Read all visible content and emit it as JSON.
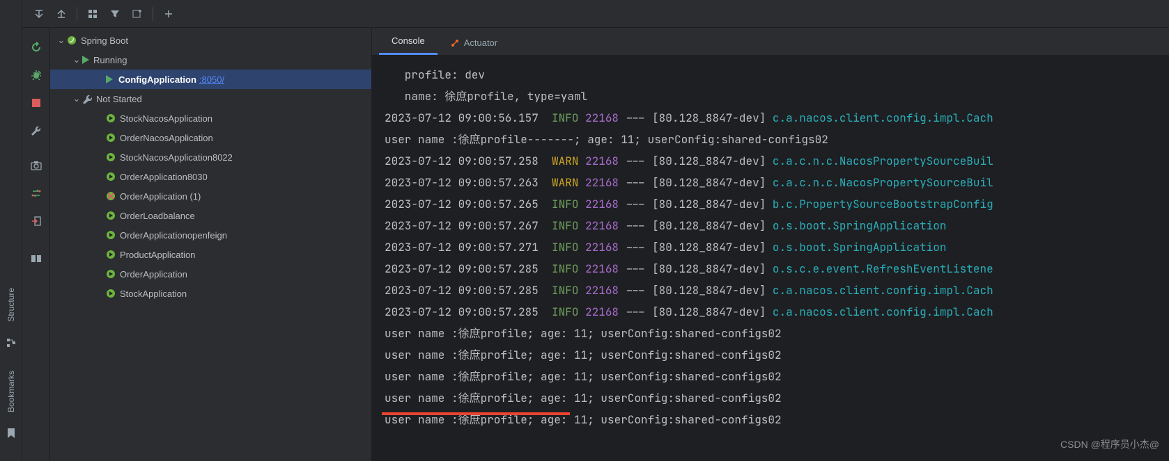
{
  "left_rail_tabs": {
    "structure": "Structure",
    "bookmarks": "Bookmarks"
  },
  "tree": {
    "root": "Spring Boot",
    "running": "Running",
    "running_app": {
      "name": "ConfigApplication",
      "port": ":8050/"
    },
    "not_started": "Not Started",
    "apps": [
      "StockNacosApplication",
      "OrderNacosApplication",
      "StockNacosApplication8022",
      "OrderApplication8030",
      "OrderApplication (1)",
      "OrderLoadbalance",
      "OrderApplicationopenfeign",
      "ProductApplication",
      "OrderApplication",
      "StockApplication"
    ]
  },
  "tabs": {
    "console": "Console",
    "actuator": "Actuator"
  },
  "console": {
    "banner": [
      "   profile: dev",
      "   name: 徐庶profile, type=yaml"
    ],
    "logs": [
      {
        "ts": "2023-07-12 09:00:56.157",
        "lvl": "INFO",
        "pid": "22168",
        "thread": "80.128_8847-dev",
        "logger": "c.a.nacos.client.config.impl.Cach"
      },
      {
        "plain": "user name :徐庶profile-------; age: 11; userConfig:shared-configs02"
      },
      {
        "ts": "2023-07-12 09:00:57.258",
        "lvl": "WARN",
        "pid": "22168",
        "thread": "80.128_8847-dev",
        "logger": "c.a.c.n.c.NacosPropertySourceBuil"
      },
      {
        "ts": "2023-07-12 09:00:57.263",
        "lvl": "WARN",
        "pid": "22168",
        "thread": "80.128_8847-dev",
        "logger": "c.a.c.n.c.NacosPropertySourceBuil"
      },
      {
        "ts": "2023-07-12 09:00:57.265",
        "lvl": "INFO",
        "pid": "22168",
        "thread": "80.128_8847-dev",
        "logger": "b.c.PropertySourceBootstrapConfig"
      },
      {
        "ts": "2023-07-12 09:00:57.267",
        "lvl": "INFO",
        "pid": "22168",
        "thread": "80.128_8847-dev",
        "logger": "o.s.boot.SpringApplication"
      },
      {
        "ts": "2023-07-12 09:00:57.271",
        "lvl": "INFO",
        "pid": "22168",
        "thread": "80.128_8847-dev",
        "logger": "o.s.boot.SpringApplication"
      },
      {
        "ts": "2023-07-12 09:00:57.285",
        "lvl": "INFO",
        "pid": "22168",
        "thread": "80.128_8847-dev",
        "logger": "o.s.c.e.event.RefreshEventListene"
      },
      {
        "ts": "2023-07-12 09:00:57.285",
        "lvl": "INFO",
        "pid": "22168",
        "thread": "80.128_8847-dev",
        "logger": "c.a.nacos.client.config.impl.Cach"
      },
      {
        "ts": "2023-07-12 09:00:57.285",
        "lvl": "INFO",
        "pid": "22168",
        "thread": "80.128_8847-dev",
        "logger": "c.a.nacos.client.config.impl.Cach"
      },
      {
        "plain": "user name :徐庶profile; age: 11; userConfig:shared-configs02"
      },
      {
        "plain": "user name :徐庶profile; age: 11; userConfig:shared-configs02"
      },
      {
        "plain": "user name :徐庶profile; age: 11; userConfig:shared-configs02"
      },
      {
        "plain": "user name :徐庶profile; age: 11; userConfig:shared-configs02"
      },
      {
        "plain": "user name :徐庶profile; age: 11; userConfig:shared-configs02"
      }
    ]
  },
  "watermark": "CSDN @程序员小杰@"
}
